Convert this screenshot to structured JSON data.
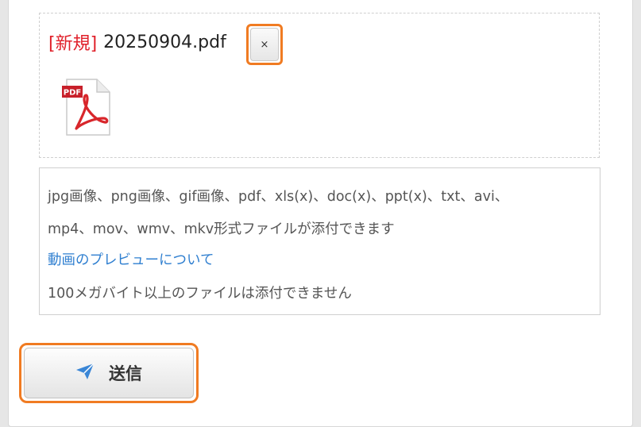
{
  "attachment": {
    "new_tag": "[新規]",
    "file_name": "20250904.pdf",
    "remove_label": "×",
    "icon": "pdf-file-icon",
    "icon_badge": "PDF"
  },
  "info": {
    "line1": "jpg画像、png画像、gif画像、pdf、xls(x)、doc(x)、ppt(x)、txt、avi、",
    "line2": "mp4、mov、wmv、mkv形式ファイルが添付できます",
    "preview_link": "動画のプレビューについて",
    "size_limit": "100メガバイト以上のファイルは添付できません"
  },
  "send_button": {
    "label": "送信",
    "icon": "paper-plane-icon"
  },
  "colors": {
    "highlight": "#f07b22",
    "new_tag": "#e0202a",
    "link": "#2f7fd0",
    "send_icon": "#3a86d6"
  }
}
